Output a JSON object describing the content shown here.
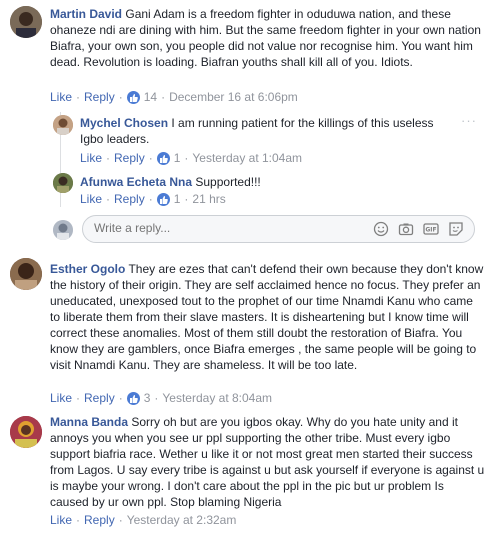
{
  "comments": [
    {
      "name": "Martin David",
      "text": "Gani Adam is a freedom fighter in oduduwa nation, and these ohaneze ndi are dining with him. But the same freedom fighter in your own nation Biafra, your own son, you people did not value nor recognise him. You want him dead. Revolution is loading. Biafran youths shall kill all of you. Idiots.",
      "like": "Like",
      "reply": "Reply",
      "reactions": "14",
      "time": "December 16 at 6:06pm"
    },
    {
      "name": "Esther Ogolo",
      "text": "They are ezes that can't defend their own because they don't know the history of their origin. They are self acclaimed hence no focus. They prefer an uneducated, unexposed tout to the prophet of our time Nnamdi Kanu who came to liberate them from their slave masters. It is disheartening but I know time will correct these anomalies. Most of them still doubt the restoration of Biafra. You know they are gamblers, once Biafra emerges , the same people will be going to visit Nnamdi Kanu. They are shameless. It will be too late.",
      "like": "Like",
      "reply": "Reply",
      "reactions": "3",
      "time": "Yesterday at 8:04am"
    },
    {
      "name": "Manna Banda",
      "text": "Sorry oh but are you igbos okay. Why do you hate unity and it annoys you when you see ur ppl supporting the other tribe. Must every igbo support biafria race. Wether u like it or not most great men started their success from Lagos. U say every tribe is against u but ask yourself if everyone is against u is maybe your wrong. I don't care about the ppl in the pic but ur problem Is caused by ur own ppl. Stop blaming Nigeria",
      "like": "Like",
      "reply": "Reply",
      "time": "Yesterday at 2:32am"
    }
  ],
  "replies": [
    {
      "name": "Mychel Chosen",
      "text": "I am running patient for the killings of this useless Igbo leaders.",
      "like": "Like",
      "reply": "Reply",
      "reactions": "1",
      "time": "Yesterday at 1:04am"
    },
    {
      "name": "Afunwa Echeta Nna",
      "text": "Supported!!!",
      "like": "Like",
      "reply": "Reply",
      "reactions": "1",
      "time": "21 hrs"
    }
  ],
  "reply_box": {
    "placeholder": "Write a reply..."
  },
  "more_menu": "···",
  "separator": "·",
  "icons": [
    "like-icon",
    "emoji-icon",
    "camera-icon",
    "gif-icon",
    "sticker-icon"
  ],
  "colors": {
    "link": "#385898",
    "action": "#4267b2",
    "meta": "#90949c",
    "like_badge": "#4b7bd4"
  }
}
